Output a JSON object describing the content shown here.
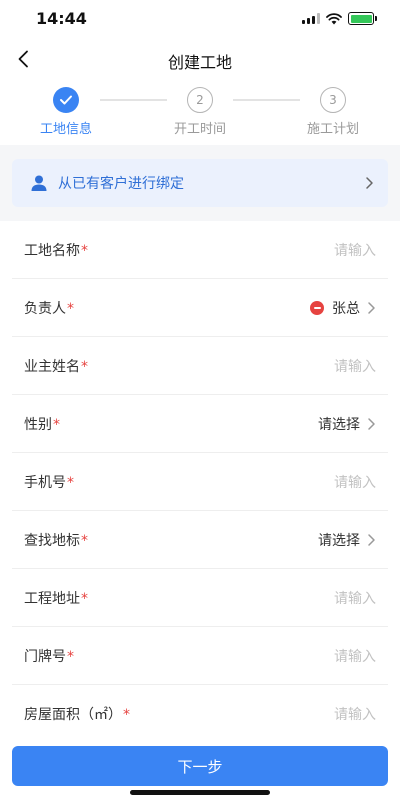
{
  "status_bar": {
    "time": "14:44"
  },
  "nav": {
    "title": "创建工地"
  },
  "steps": [
    {
      "number": "1",
      "label": "工地信息",
      "state": "done"
    },
    {
      "number": "2",
      "label": "开工时间",
      "state": "todo"
    },
    {
      "number": "3",
      "label": "施工计划",
      "state": "todo"
    }
  ],
  "bind": {
    "label": "从已有客户进行绑定"
  },
  "form": {
    "fields": [
      {
        "label": "工地名称",
        "required": "*",
        "value": "请输入",
        "kind": "input"
      },
      {
        "label": "负责人",
        "required": "*",
        "value": "张总",
        "kind": "select-filled"
      },
      {
        "label": "业主姓名",
        "required": "*",
        "value": "请输入",
        "kind": "input"
      },
      {
        "label": "性别",
        "required": "*",
        "value": "请选择",
        "kind": "select"
      },
      {
        "label": "手机号",
        "required": "*",
        "value": "请输入",
        "kind": "input"
      },
      {
        "label": "查找地标",
        "required": "*",
        "value": "请选择",
        "kind": "select"
      },
      {
        "label": "工程地址",
        "required": "*",
        "value": "请输入",
        "kind": "input"
      },
      {
        "label": "门牌号",
        "required": "*",
        "value": "请输入",
        "kind": "input"
      },
      {
        "label": "房屋面积（㎡）",
        "required": "*",
        "value": "请输入",
        "kind": "input"
      }
    ]
  },
  "footer": {
    "next_label": "下一步"
  },
  "colors": {
    "primary": "#3a84f3",
    "required": "#e64340",
    "bind_bg": "#ebf1fd"
  }
}
